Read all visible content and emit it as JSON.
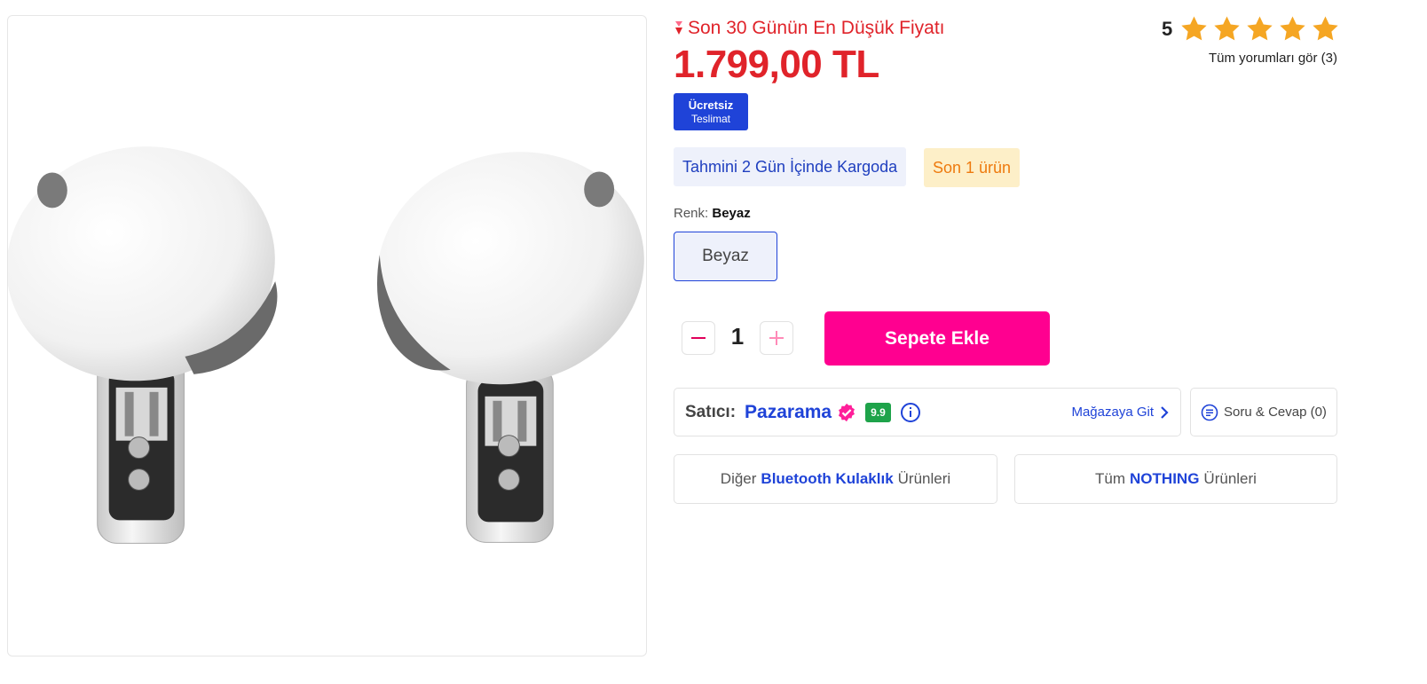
{
  "price_block": {
    "lowest_price_text": "Son 30 Günün En Düşük Fiyatı",
    "price": "1.799,00 TL"
  },
  "badges": {
    "free_shipping_line1": "Ücretsiz",
    "free_shipping_line2": "Teslimat",
    "shipping_estimate": "Tahmini 2 Gün İçinde Kargoda",
    "stock": "Son 1 ürün"
  },
  "rating": {
    "score": "5",
    "stars": 5,
    "reviews_link": "Tüm yorumları gör (3)"
  },
  "color": {
    "label": "Renk:",
    "selected": "Beyaz",
    "options": [
      "Beyaz"
    ]
  },
  "purchase": {
    "quantity": "1",
    "add_to_cart": "Sepete Ekle"
  },
  "seller": {
    "label": "Satıcı:",
    "name": "Pazarama",
    "score": "9.9",
    "store_link": "Mağazaya Git"
  },
  "qa": {
    "label": "Soru & Cevap (0)"
  },
  "related": {
    "category_prefix": "Diğer",
    "category_name": "Bluetooth Kulaklık",
    "category_suffix": "Ürünleri",
    "brand_prefix": "Tüm",
    "brand_name": "NOTHING",
    "brand_suffix": "Ürünleri"
  },
  "colors": {
    "price_red": "#e0232a",
    "brand_blue": "#1f43d8",
    "cta_pink": "#ff0090",
    "star_orange": "#f5a623",
    "score_green": "#1ea34a"
  },
  "icons": [
    "price-down-icon",
    "star-icon",
    "minus-icon",
    "plus-icon",
    "verified-icon",
    "info-icon",
    "chevron-right-icon",
    "qa-icon"
  ]
}
